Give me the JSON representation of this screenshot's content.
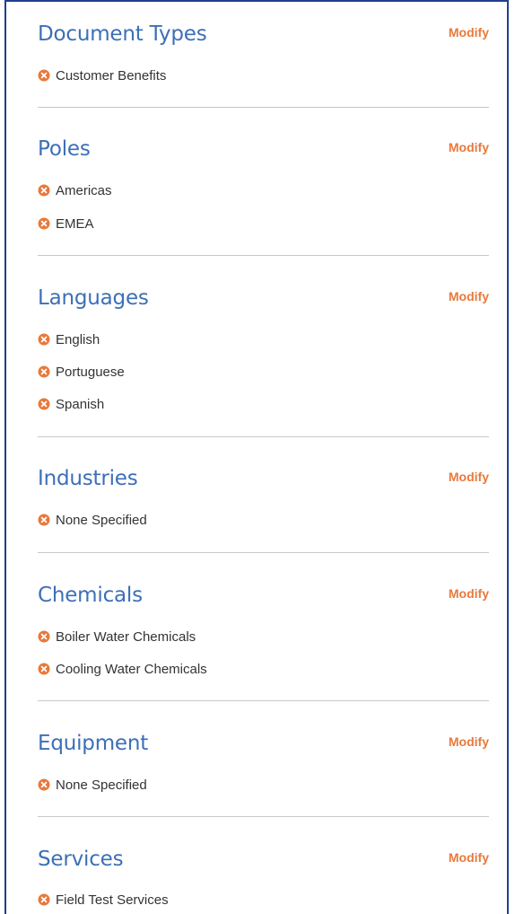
{
  "modify_label": "Modify",
  "colors": {
    "accent_title": "#3d6fb6",
    "modify_link": "#e8793a",
    "remove_icon": "#e8793a",
    "panel_border": "#1f3f8f"
  },
  "sections": [
    {
      "title": "Document Types",
      "items": [
        "Customer Benefits"
      ]
    },
    {
      "title": "Poles",
      "items": [
        "Americas",
        "EMEA"
      ]
    },
    {
      "title": "Languages",
      "items": [
        "English",
        "Portuguese",
        "Spanish"
      ]
    },
    {
      "title": "Industries",
      "items": [
        "None Specified"
      ]
    },
    {
      "title": "Chemicals",
      "items": [
        "Boiler Water Chemicals",
        "Cooling Water Chemicals"
      ]
    },
    {
      "title": "Equipment",
      "items": [
        "None Specified"
      ]
    },
    {
      "title": "Services",
      "items": [
        "Field Test Services"
      ]
    }
  ]
}
